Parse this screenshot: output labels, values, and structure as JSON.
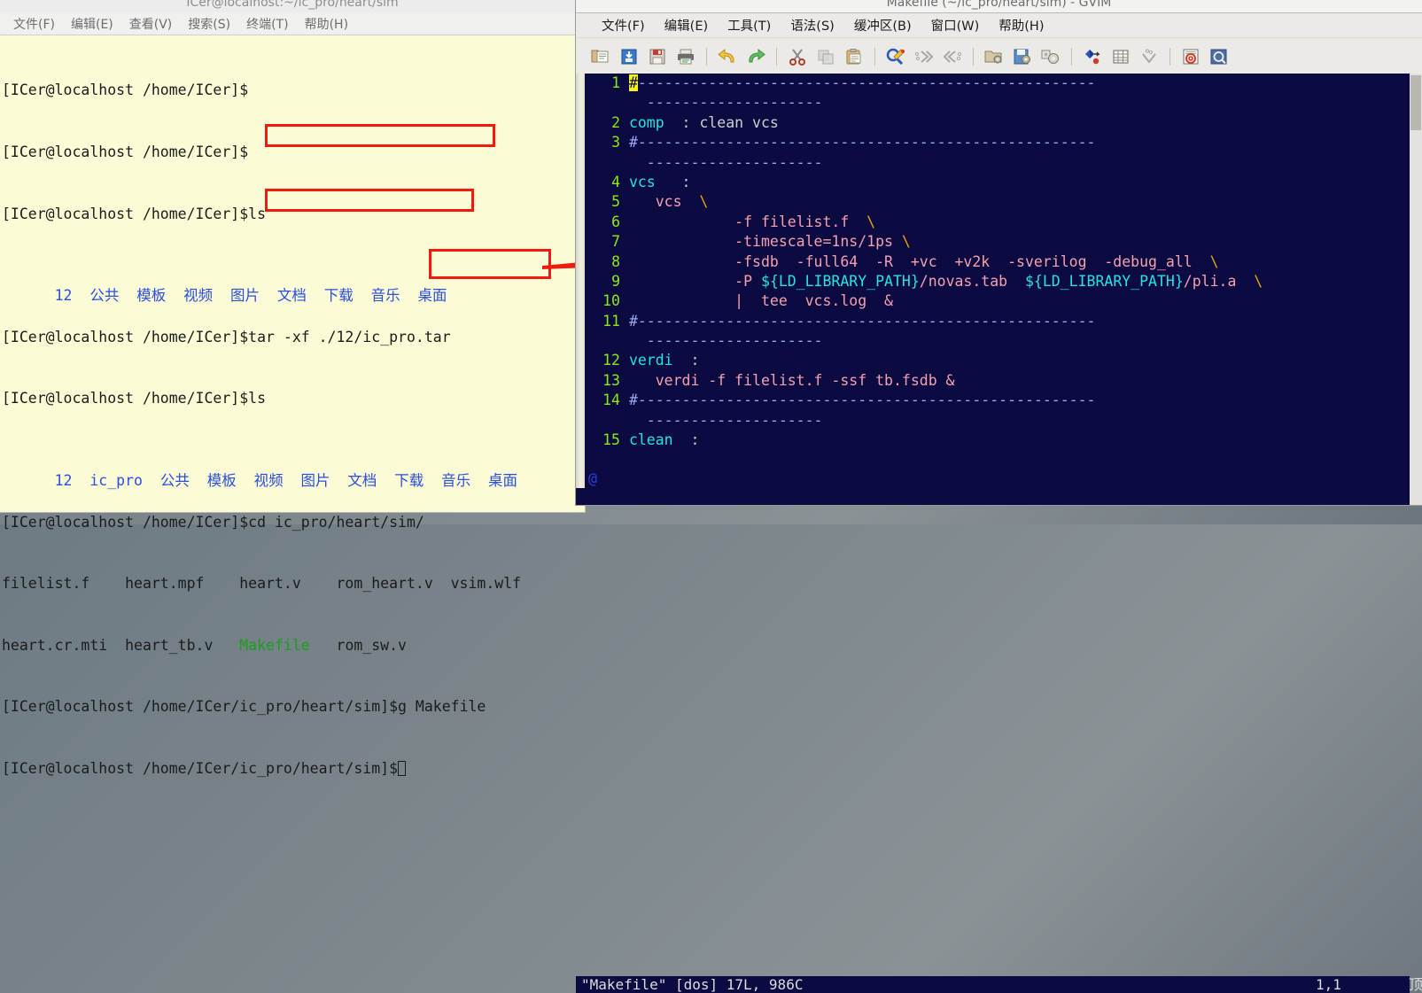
{
  "desktop": {
    "background": "#75808700"
  },
  "terminal": {
    "title": "ICer@localhost:~/ic_pro/heart/sim",
    "menu": [
      {
        "label": "文件(F)",
        "name": "file"
      },
      {
        "label": "编辑(E)",
        "name": "edit"
      },
      {
        "label": "查看(V)",
        "name": "view"
      },
      {
        "label": "搜索(S)",
        "name": "search"
      },
      {
        "label": "终端(T)",
        "name": "terminal"
      },
      {
        "label": "帮助(H)",
        "name": "help"
      }
    ],
    "prompt_home": "[ICer@localhost /home/ICer]$",
    "prompt_sim": "[ICer@localhost /home/ICer/ic_pro/heart/sim]$",
    "lines": [
      {
        "type": "prompt",
        "prompt": "[ICer@localhost /home/ICer]$",
        "cmd": ""
      },
      {
        "type": "prompt",
        "prompt": "[ICer@localhost /home/ICer]$",
        "cmd": ""
      },
      {
        "type": "prompt",
        "prompt": "[ICer@localhost /home/ICer]$",
        "cmd": "ls"
      },
      {
        "type": "ls1",
        "items": [
          "12",
          "公共",
          "模板",
          "视频",
          "图片",
          "文档",
          "下载",
          "音乐",
          "桌面"
        ]
      },
      {
        "type": "prompt",
        "prompt": "[ICer@localhost /home/ICer]$",
        "cmd": "tar -xf ./12/ic_pro.tar"
      },
      {
        "type": "prompt",
        "prompt": "[ICer@localhost /home/ICer]$",
        "cmd": "ls"
      },
      {
        "type": "ls2",
        "items": [
          "12",
          "ic_pro",
          "公共",
          "模板",
          "视频",
          "图片",
          "文档",
          "下载",
          "音乐",
          "桌面"
        ]
      },
      {
        "type": "prompt",
        "prompt": "[ICer@localhost /home/ICer]$",
        "cmd": "cd ic_pro/heart/sim/"
      },
      {
        "type": "files1",
        "text": "filelist.f    heart.mpf    heart.v    rom_heart.v  vsim.wlf"
      },
      {
        "type": "files2",
        "pre": "heart.cr.mti  heart_tb.v   ",
        "green": "Makefile",
        "post": "   rom_sw.v"
      },
      {
        "type": "prompt",
        "prompt": "[ICer@localhost /home/ICer/ic_pro/heart/sim]$",
        "cmd": "g Makefile"
      },
      {
        "type": "promptcur",
        "prompt": "[ICer@localhost /home/ICer/ic_pro/heart/sim]$",
        "cmd": ""
      }
    ],
    "annotations": [
      {
        "name": "tar-command-highlight",
        "text": "tar -xf ./12/ic_pro.tar"
      },
      {
        "name": "cd-command-highlight",
        "text": "cd ic_pro/heart/sim/"
      },
      {
        "name": "gvim-command-highlight",
        "text": "g Makefile"
      }
    ]
  },
  "gvim": {
    "title": "Makefile (~/ic_pro/heart/sim) - GVIM",
    "menu": [
      {
        "label": "文件(F)",
        "name": "file"
      },
      {
        "label": "编辑(E)",
        "name": "edit"
      },
      {
        "label": "工具(T)",
        "name": "tools"
      },
      {
        "label": "语法(S)",
        "name": "syntax"
      },
      {
        "label": "缓冲区(B)",
        "name": "buffers"
      },
      {
        "label": "窗口(W)",
        "name": "window"
      },
      {
        "label": "帮助(H)",
        "name": "help"
      }
    ],
    "toolbar": [
      {
        "icon": "open-file-icon",
        "name": "open-file-button"
      },
      {
        "icon": "load-session-icon",
        "name": "load-session-button"
      },
      {
        "icon": "save-icon",
        "name": "save-button"
      },
      {
        "icon": "print-icon",
        "name": "print-button"
      },
      {
        "sep": true
      },
      {
        "icon": "undo-icon",
        "name": "undo-button"
      },
      {
        "icon": "redo-icon",
        "name": "redo-button"
      },
      {
        "sep": true
      },
      {
        "icon": "cut-icon",
        "name": "cut-button"
      },
      {
        "icon": "copy-icon",
        "name": "copy-button"
      },
      {
        "icon": "paste-icon",
        "name": "paste-button"
      },
      {
        "sep": true
      },
      {
        "icon": "find-icon",
        "name": "find-button"
      },
      {
        "icon": "find-next-icon",
        "name": "find-next-button"
      },
      {
        "icon": "find-prev-icon",
        "name": "find-prev-button"
      },
      {
        "sep": true
      },
      {
        "icon": "open-session-icon",
        "name": "open-session-button"
      },
      {
        "icon": "save-session-icon",
        "name": "save-session-button"
      },
      {
        "icon": "run-script-icon",
        "name": "run-script-button"
      },
      {
        "sep": true
      },
      {
        "icon": "make-icon",
        "name": "make-button"
      },
      {
        "icon": "build-tags-icon",
        "name": "build-tags-button"
      },
      {
        "icon": "jump-tag-icon",
        "name": "jump-tag-button"
      },
      {
        "sep": true
      },
      {
        "icon": "help-icon",
        "name": "help-button"
      },
      {
        "icon": "find-help-icon",
        "name": "find-help-button"
      }
    ],
    "code_lines": [
      {
        "num": "1",
        "segs": [
          {
            "t": "#",
            "c": "cursor"
          },
          {
            "t": "----------------------------------------------------",
            "c": "dash"
          }
        ]
      },
      {
        "num": "",
        "segs": [
          {
            "t": "  --------------------",
            "c": "dash"
          }
        ]
      },
      {
        "num": "2",
        "segs": [
          {
            "t": "comp",
            "c": "cyan"
          },
          {
            "t": "  : ",
            "c": "gray"
          },
          {
            "t": "clean vcs",
            "c": "gray"
          }
        ]
      },
      {
        "num": "3",
        "segs": [
          {
            "t": "#",
            "c": "hash"
          },
          {
            "t": "----------------------------------------------------",
            "c": "dash"
          }
        ]
      },
      {
        "num": "",
        "segs": [
          {
            "t": "  --------------------",
            "c": "dash"
          }
        ]
      },
      {
        "num": "4",
        "segs": [
          {
            "t": "vcs",
            "c": "cyan"
          },
          {
            "t": "   :",
            "c": "gray"
          }
        ]
      },
      {
        "num": "5",
        "segs": [
          {
            "t": "   vcs  ",
            "c": "text"
          },
          {
            "t": "\\",
            "c": "yellow"
          }
        ]
      },
      {
        "num": "6",
        "segs": [
          {
            "t": "            -f filelist.f  ",
            "c": "text"
          },
          {
            "t": "\\",
            "c": "yellow"
          }
        ]
      },
      {
        "num": "7",
        "segs": [
          {
            "t": "            -timescale=1ns/1ps ",
            "c": "text"
          },
          {
            "t": "\\",
            "c": "yellow"
          }
        ]
      },
      {
        "num": "8",
        "segs": [
          {
            "t": "            -fsdb  -full64  -R  +vc  +v2k  -sverilog  -debug_all  ",
            "c": "text"
          },
          {
            "t": "\\",
            "c": "yellow"
          }
        ]
      },
      {
        "num": "9",
        "segs": [
          {
            "t": "            -P ",
            "c": "text"
          },
          {
            "t": "${LD_LIBRARY_PATH}",
            "c": "cyan"
          },
          {
            "t": "/novas.tab  ",
            "c": "text"
          },
          {
            "t": "${LD_LIBRARY_PATH}",
            "c": "cyan"
          },
          {
            "t": "/pli.a  ",
            "c": "text"
          },
          {
            "t": "\\",
            "c": "yellow"
          }
        ]
      },
      {
        "num": "10",
        "segs": [
          {
            "t": "            |  tee  vcs.log  &",
            "c": "text"
          }
        ]
      },
      {
        "num": "11",
        "segs": [
          {
            "t": "#",
            "c": "hash"
          },
          {
            "t": "----------------------------------------------------",
            "c": "dash"
          }
        ]
      },
      {
        "num": "",
        "segs": [
          {
            "t": "  --------------------",
            "c": "dash"
          }
        ]
      },
      {
        "num": "12",
        "segs": [
          {
            "t": "verdi",
            "c": "cyan"
          },
          {
            "t": "  :",
            "c": "gray"
          }
        ]
      },
      {
        "num": "13",
        "segs": [
          {
            "t": "   verdi -f filelist.f -ssf tb.fsdb &",
            "c": "text"
          }
        ]
      },
      {
        "num": "14",
        "segs": [
          {
            "t": "#",
            "c": "hash"
          },
          {
            "t": "----------------------------------------------------",
            "c": "dash"
          }
        ]
      },
      {
        "num": "",
        "segs": [
          {
            "t": "  --------------------",
            "c": "dash"
          }
        ]
      },
      {
        "num": "15",
        "segs": [
          {
            "t": "clean",
            "c": "cyan"
          },
          {
            "t": "  :",
            "c": "gray"
          }
        ]
      }
    ],
    "tilde_line": "@",
    "status": {
      "file": "\"Makefile\" [dos] 17L, 986C",
      "position": "1,1",
      "scroll": "顶端"
    }
  }
}
